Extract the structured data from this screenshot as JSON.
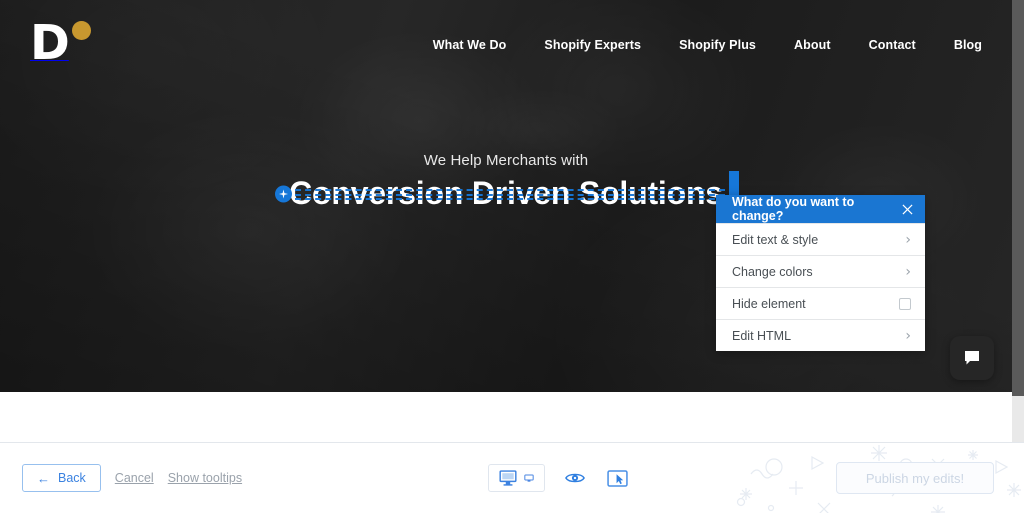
{
  "site": {
    "logo": {
      "letter": "D",
      "dot_color": "#c8982f",
      "name": "site-logo"
    },
    "nav": [
      {
        "label": "What We Do"
      },
      {
        "label": "Shopify Experts"
      },
      {
        "label": "Shopify Plus"
      },
      {
        "label": "About"
      },
      {
        "label": "Contact"
      },
      {
        "label": "Blog"
      }
    ],
    "hero": {
      "eyebrow": "We Help Merchants with",
      "title": "Conversion Driven Solutions"
    },
    "chat_widget": {
      "icon": "chat-bubble-icon"
    }
  },
  "popup": {
    "title": "What do you want to change?",
    "close_icon": "close-icon",
    "accent_color": "#1a76d2",
    "rows": [
      {
        "label": "Edit text & style",
        "control": "chevron-right-icon"
      },
      {
        "label": "Change colors",
        "control": "chevron-right-icon"
      },
      {
        "label": "Hide element",
        "control": "checkbox"
      },
      {
        "label": "Edit HTML",
        "control": "chevron-right-icon"
      }
    ],
    "chevron_glyph": "›"
  },
  "toolbar": {
    "back_label": "Back",
    "back_arrow_glyph": "←",
    "cancel_label": "Cancel",
    "tooltips_label": "Show tooltips",
    "device_icon": "desktop-monitor-icon",
    "device_caret_icon": "chevron-down-icon",
    "preview_icon": "eye-icon",
    "interactive_icon": "screen-cursor-icon",
    "publish_label": "Publish my edits!"
  }
}
